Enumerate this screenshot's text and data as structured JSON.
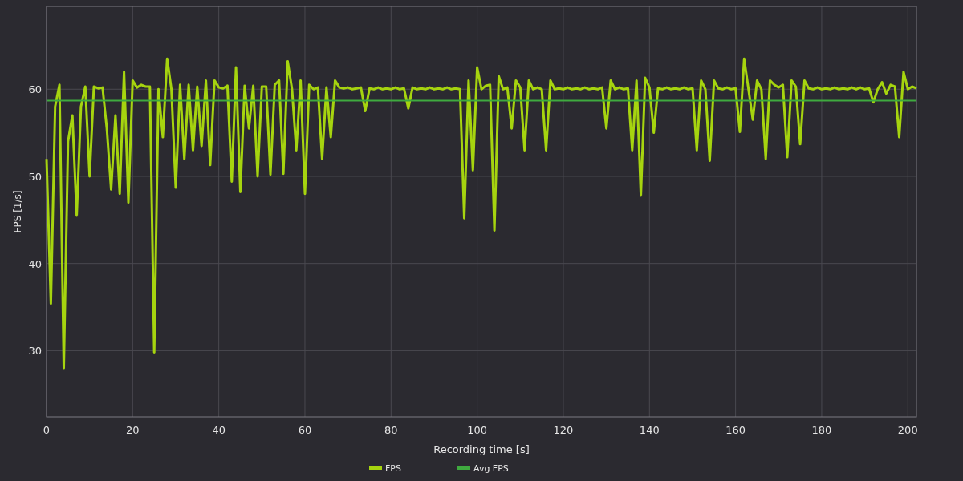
{
  "chart": {
    "chart_data": {
      "type": "line",
      "grid": true,
      "legend": "bottom",
      "xlabel": "Recording time [s]",
      "ylabel": "FPS [1/s]",
      "xlim": [
        0,
        202
      ],
      "ylim": [
        22.4,
        69.5
      ],
      "xticks": [
        0,
        20,
        40,
        60,
        80,
        100,
        120,
        140,
        160,
        180,
        200
      ],
      "yticks": [
        30,
        40,
        50,
        60
      ],
      "x": [
        0,
        1,
        2,
        3,
        4,
        5,
        6,
        7,
        8,
        9,
        10,
        11,
        12,
        13,
        14,
        15,
        16,
        17,
        18,
        19,
        20,
        21,
        22,
        23,
        24,
        25,
        26,
        27,
        28,
        29,
        30,
        31,
        32,
        33,
        34,
        35,
        36,
        37,
        38,
        39,
        40,
        41,
        42,
        43,
        44,
        45,
        46,
        47,
        48,
        49,
        50,
        51,
        52,
        53,
        54,
        55,
        56,
        57,
        58,
        59,
        60,
        61,
        62,
        63,
        64,
        65,
        66,
        67,
        68,
        69,
        70,
        71,
        72,
        73,
        74,
        75,
        76,
        77,
        78,
        79,
        80,
        81,
        82,
        83,
        84,
        85,
        86,
        87,
        88,
        89,
        90,
        91,
        92,
        93,
        94,
        95,
        96,
        97,
        98,
        99,
        100,
        101,
        102,
        103,
        104,
        105,
        106,
        107,
        108,
        109,
        110,
        111,
        112,
        113,
        114,
        115,
        116,
        117,
        118,
        119,
        120,
        121,
        122,
        123,
        124,
        125,
        126,
        127,
        128,
        129,
        130,
        131,
        132,
        133,
        134,
        135,
        136,
        137,
        138,
        139,
        140,
        141,
        142,
        143,
        144,
        145,
        146,
        147,
        148,
        149,
        150,
        151,
        152,
        153,
        154,
        155,
        156,
        157,
        158,
        159,
        160,
        161,
        162,
        163,
        164,
        165,
        166,
        167,
        168,
        169,
        170,
        171,
        172,
        173,
        174,
        175,
        176,
        177,
        178,
        179,
        180,
        181,
        182,
        183,
        184,
        185,
        186,
        187,
        188,
        189,
        190,
        191,
        192,
        193,
        194,
        195,
        196,
        197,
        198,
        199,
        200,
        201,
        202
      ],
      "series": [
        {
          "name": "FPS",
          "color": "#a6d40f",
          "values": [
            52,
            35.4,
            58,
            60.5,
            28,
            54,
            57,
            45.5,
            58,
            60.3,
            50,
            60.3,
            60.1,
            60.2,
            55.5,
            48.5,
            57,
            48,
            62,
            47,
            61,
            60.2,
            60.5,
            60.3,
            60.3,
            29.8,
            60,
            54.5,
            63.5,
            60,
            48.7,
            60.5,
            52,
            60.5,
            53,
            60.3,
            53.5,
            61,
            51.3,
            61,
            60.2,
            60.1,
            60.4,
            49.4,
            62.5,
            48.2,
            60.4,
            55.5,
            60.4,
            50,
            60.3,
            60.3,
            50.2,
            60.5,
            61,
            50.3,
            63.2,
            60,
            53,
            61,
            48,
            60.5,
            60,
            60.2,
            52,
            60.2,
            54.5,
            61,
            60.2,
            60.1,
            60.2,
            60,
            60.1,
            60.2,
            57.5,
            60.1,
            60,
            60.2,
            60,
            60.1,
            60,
            60.2,
            60,
            60.1,
            57.8,
            60.2,
            60,
            60.1,
            60,
            60.2,
            60,
            60.1,
            60,
            60.2,
            60,
            60.1,
            60,
            45.2,
            61,
            50.7,
            62.5,
            60,
            60.4,
            60.5,
            43.8,
            61.5,
            60,
            60.2,
            55.5,
            61,
            60.2,
            53,
            61,
            60,
            60.2,
            60,
            53,
            61,
            60,
            60.1,
            60,
            60.2,
            60,
            60.1,
            60,
            60.2,
            60,
            60.1,
            60,
            60.2,
            55.5,
            61,
            60,
            60.2,
            60,
            60.1,
            53,
            61,
            47.8,
            61.3,
            60.2,
            55,
            60.1,
            60,
            60.2,
            60,
            60.1,
            60,
            60.2,
            60,
            60.1,
            53,
            61,
            60,
            51.8,
            61,
            60.1,
            60,
            60.2,
            60,
            60.1,
            55.1,
            63.5,
            60,
            56.5,
            61,
            60,
            52,
            61,
            60.5,
            60.2,
            60.5,
            52.2,
            61,
            60.3,
            53.7,
            61,
            60.1,
            60,
            60.2,
            60,
            60.1,
            60,
            60.2,
            60,
            60.1,
            60,
            60.2,
            60,
            60.2,
            60,
            60.1,
            58.5,
            60,
            60.8,
            59.5,
            60.5,
            60.3,
            54.5,
            62,
            60,
            60.3,
            60.1
          ]
        },
        {
          "name": "Avg FPS",
          "color": "#3faa3f",
          "values": [
            58.7,
            58.7,
            58.7,
            58.7,
            58.7,
            58.7,
            58.7,
            58.7,
            58.7,
            58.7,
            58.7,
            58.7,
            58.7,
            58.7,
            58.7,
            58.7,
            58.7,
            58.7,
            58.7,
            58.7,
            58.7,
            58.7,
            58.7,
            58.7,
            58.7,
            58.7,
            58.7,
            58.7,
            58.7,
            58.7,
            58.7,
            58.7,
            58.7,
            58.7,
            58.7,
            58.7,
            58.7,
            58.7,
            58.7,
            58.7,
            58.7,
            58.7,
            58.7,
            58.7,
            58.7,
            58.7,
            58.7,
            58.7,
            58.7,
            58.7,
            58.7,
            58.7,
            58.7,
            58.7,
            58.7,
            58.7,
            58.7,
            58.7,
            58.7,
            58.7,
            58.7,
            58.7,
            58.7,
            58.7,
            58.7,
            58.7,
            58.7,
            58.7,
            58.7,
            58.7,
            58.7,
            58.7,
            58.7,
            58.7,
            58.7,
            58.7,
            58.7,
            58.7,
            58.7,
            58.7,
            58.7,
            58.7,
            58.7,
            58.7,
            58.7,
            58.7,
            58.7,
            58.7,
            58.7,
            58.7,
            58.7,
            58.7,
            58.7,
            58.7,
            58.7,
            58.7,
            58.7,
            58.7,
            58.7,
            58.7,
            58.7,
            58.7,
            58.7,
            58.7,
            58.7,
            58.7,
            58.7,
            58.7,
            58.7,
            58.7,
            58.7,
            58.7,
            58.7,
            58.7,
            58.7,
            58.7,
            58.7,
            58.7,
            58.7,
            58.7,
            58.7,
            58.7,
            58.7,
            58.7,
            58.7,
            58.7,
            58.7,
            58.7,
            58.7,
            58.7,
            58.7,
            58.7,
            58.7,
            58.7,
            58.7,
            58.7,
            58.7,
            58.7,
            58.7,
            58.7,
            58.7,
            58.7,
            58.7,
            58.7,
            58.7,
            58.7,
            58.7,
            58.7,
            58.7,
            58.7,
            58.7,
            58.7,
            58.7,
            58.7,
            58.7,
            58.7,
            58.7,
            58.7,
            58.7,
            58.7,
            58.7,
            58.7,
            58.7,
            58.7,
            58.7,
            58.7,
            58.7,
            58.7,
            58.7,
            58.7,
            58.7,
            58.7,
            58.7,
            58.7,
            58.7,
            58.7,
            58.7,
            58.7,
            58.7,
            58.7,
            58.7,
            58.7,
            58.7,
            58.7,
            58.7,
            58.7,
            58.7,
            58.7,
            58.7,
            58.7,
            58.7,
            58.7,
            58.7,
            58.7,
            58.7,
            58.7,
            58.7,
            58.7,
            58.7,
            58.7,
            58.7,
            58.7,
            58.7
          ]
        }
      ]
    }
  }
}
